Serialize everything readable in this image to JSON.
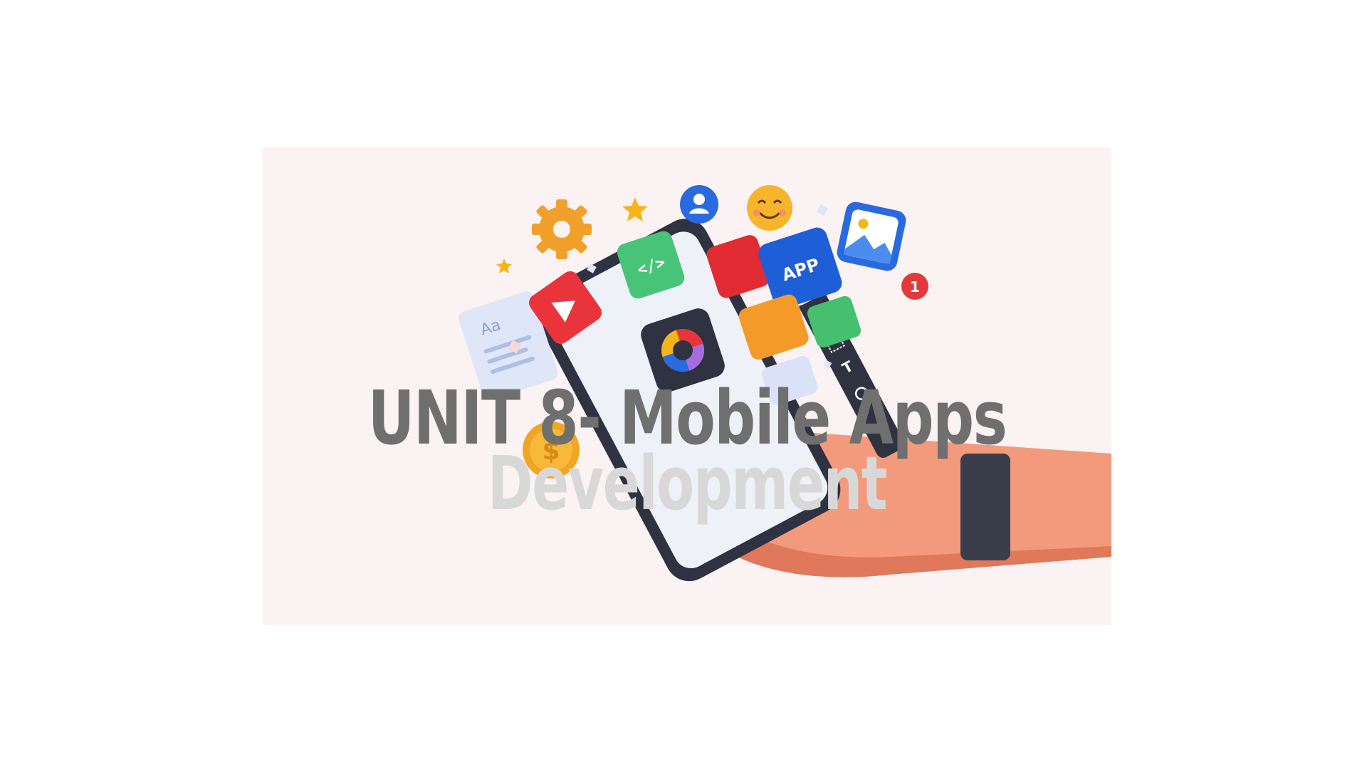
{
  "slide": {
    "title_line1": "UNIT 8- Mobile Apps",
    "title_line2": "Development"
  },
  "illustration": {
    "description_icons": [
      "gear-icon",
      "star-icon",
      "user-icon",
      "smiley-icon",
      "gallery-icon",
      "code-icon",
      "app-icon",
      "play-icon",
      "color-wheel-icon",
      "document-icon",
      "coin-icon",
      "notification-badge-icon",
      "toolbar-icon",
      "hand-icon",
      "phone-icon"
    ],
    "app_tile_label": "APP",
    "code_tile_label": "</>",
    "doc_tile_label": "Aa",
    "coin_label": "$",
    "badge_count": "1"
  },
  "colors": {
    "panel_bg": "#fbf3f3",
    "title_primary": "#6f6f6f",
    "title_secondary": "#d8d8d8"
  }
}
